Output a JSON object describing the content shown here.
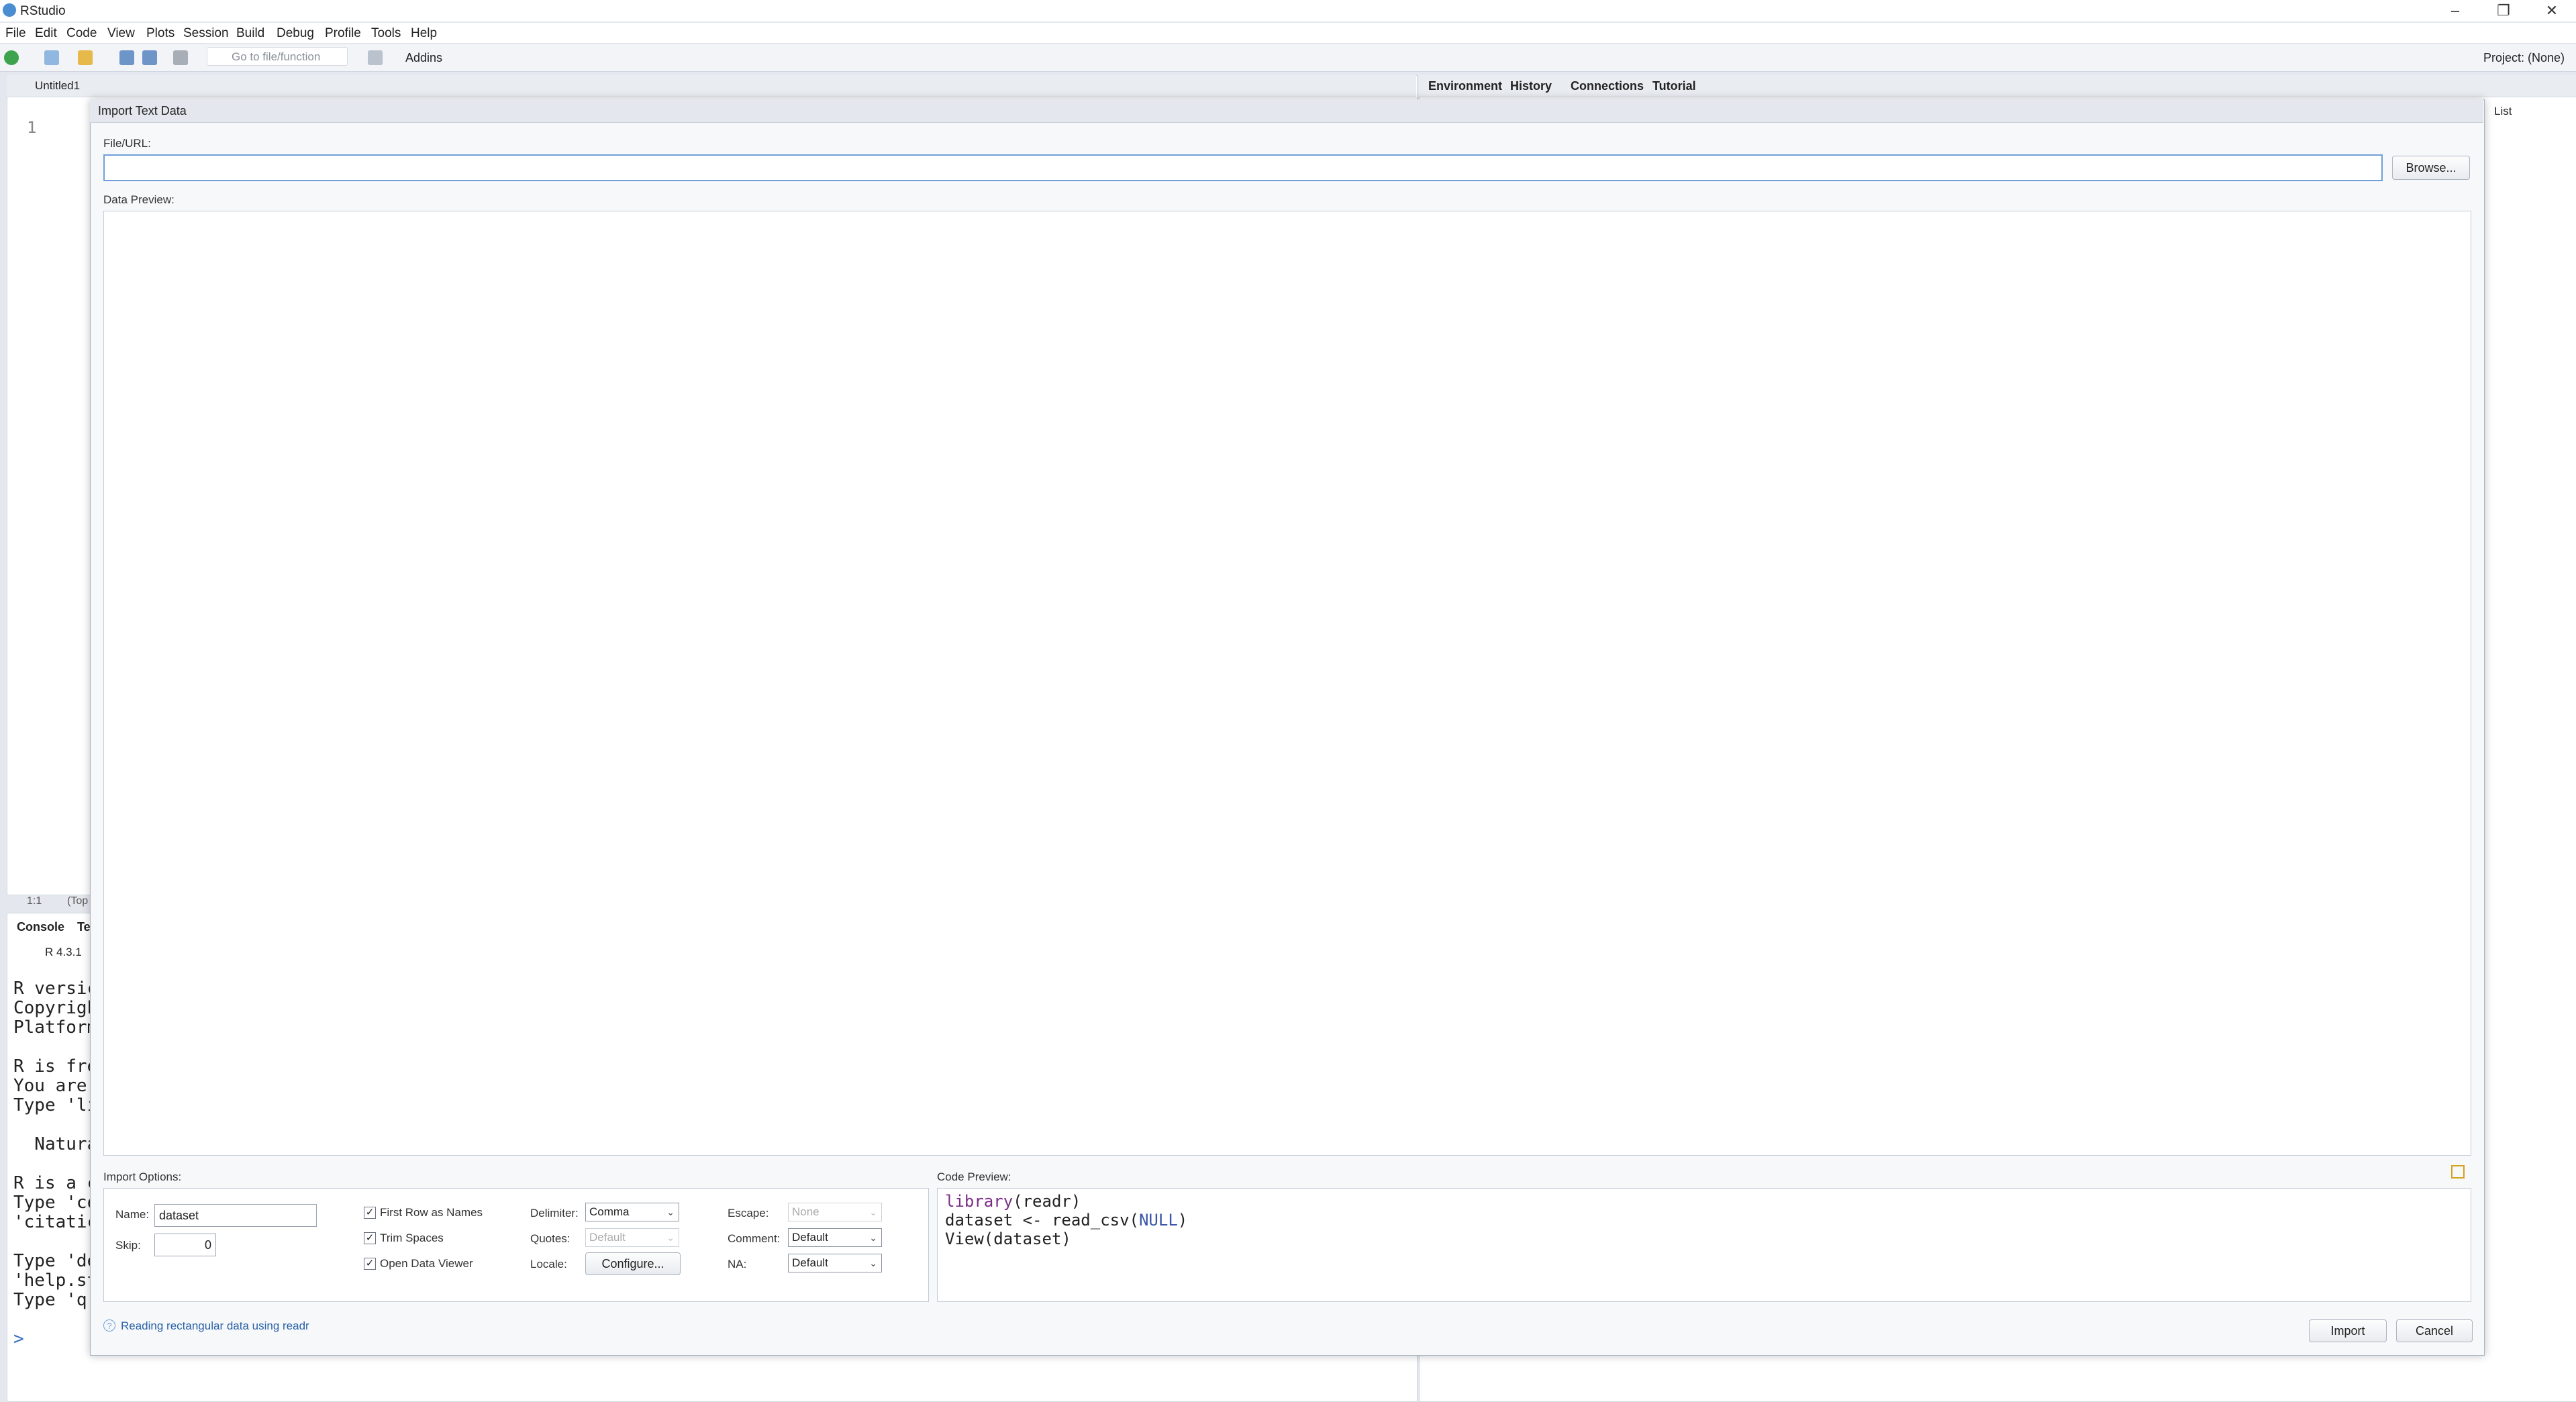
{
  "window": {
    "title": "RStudio",
    "minimize": "–",
    "restore": "❐",
    "close": "✕"
  },
  "menu": [
    "File",
    "Edit",
    "Code",
    "View",
    "Plots",
    "Session",
    "Build",
    "Debug",
    "Profile",
    "Tools",
    "Help"
  ],
  "toolbar": {
    "goto_placeholder": "Go to file/function",
    "addins_label": "Addins",
    "project_label": "Project: (None)"
  },
  "editor": {
    "tab_label": "Untitled1",
    "line_number": "1",
    "cursor_pos": "1:1",
    "scope": "(Top"
  },
  "console": {
    "tab_console": "Console",
    "tab_terminal": "Te",
    "version": "R 4.3.1",
    "lines": [
      "R versic",
      "Copyrigh",
      "Platform",
      "",
      "R is fre",
      "You are",
      "Type 'li",
      "",
      "  Natura",
      "",
      "R is a c",
      "Type 'co",
      "'citatic",
      "",
      "Type 'de",
      "'help.st",
      "Type 'q("
    ],
    "prompt": ">"
  },
  "right_pane": {
    "tabs": [
      "Environment",
      "History",
      "Connections",
      "Tutorial"
    ],
    "list_label": "List"
  },
  "dialog": {
    "title": "Import Text Data",
    "file_url_label": "File/URL:",
    "file_url_value": "",
    "browse_label": "Browse...",
    "data_preview_label": "Data Preview:",
    "import_options_label": "Import Options:",
    "code_preview_label": "Code Preview:",
    "name_label": "Name:",
    "name_value": "dataset",
    "skip_label": "Skip:",
    "skip_value": "0",
    "first_row_label": "First Row as Names",
    "first_row_checked": true,
    "trim_spaces_label": "Trim Spaces",
    "trim_spaces_checked": true,
    "open_viewer_label": "Open Data Viewer",
    "open_viewer_checked": true,
    "delimiter_label": "Delimiter:",
    "delimiter_value": "Comma",
    "quotes_label": "Quotes:",
    "quotes_value": "Default",
    "locale_label": "Locale:",
    "configure_label": "Configure...",
    "escape_label": "Escape:",
    "escape_value": "None",
    "comment_label": "Comment:",
    "comment_value": "Default",
    "na_label": "NA:",
    "na_value": "Default",
    "code_lines": {
      "line1_fn": "library",
      "line1_rest": "(readr)",
      "line2_a": "dataset <- read_csv(",
      "line2_null": "NULL",
      "line2_b": ")",
      "line3": "View(dataset)"
    },
    "help_link": "Reading rectangular data using readr",
    "import_label": "Import",
    "cancel_label": "Cancel"
  },
  "colors": {
    "accent": "#6f9fd8",
    "link": "#2a62a8",
    "keyword": "#7a2f87",
    "null": "#3a56a8"
  }
}
